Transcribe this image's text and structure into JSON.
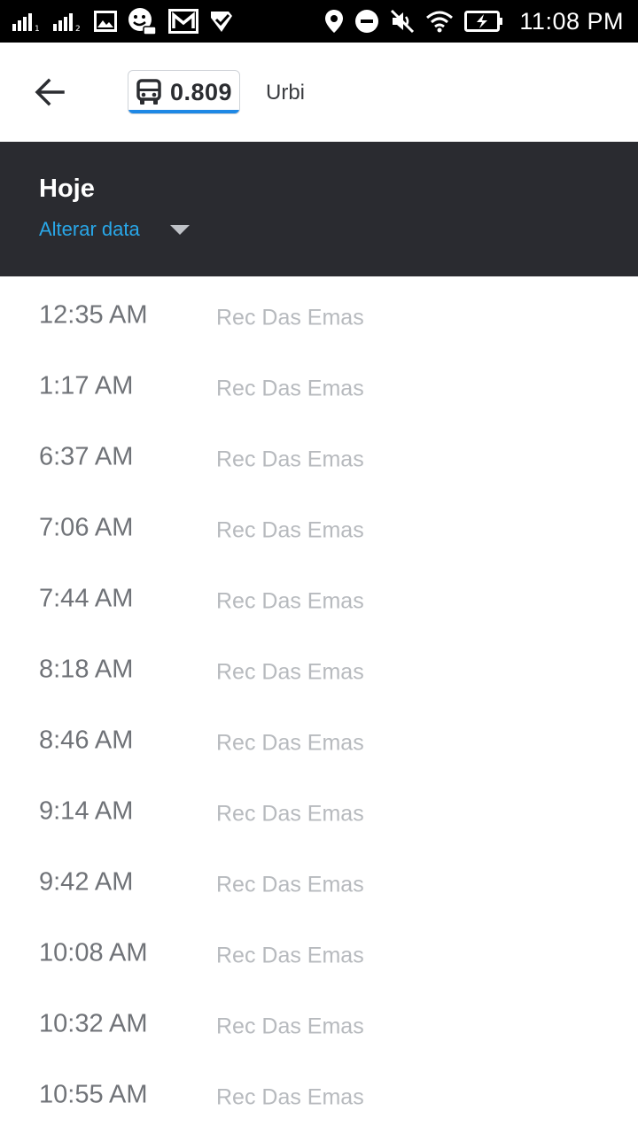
{
  "status_bar": {
    "time": "11:08 PM",
    "left_icons": [
      "signal-1-icon",
      "signal-2-icon",
      "gallery-icon",
      "moovit-icon",
      "gmail-icon",
      "check-app-icon"
    ],
    "right_icons": [
      "location-icon",
      "do-not-disturb-icon",
      "mute-icon",
      "wifi-icon",
      "battery-charging-icon"
    ]
  },
  "app_bar": {
    "back_icon": "arrow-back-icon",
    "route_icon": "bus-icon",
    "route_number": "0.809",
    "operator": "Urbi"
  },
  "date_header": {
    "title": "Hoje",
    "change_label": "Alterar data"
  },
  "schedule": [
    {
      "time": "12:35 AM",
      "destination": "Rec Das Emas"
    },
    {
      "time": "1:17 AM",
      "destination": "Rec Das Emas"
    },
    {
      "time": "6:37 AM",
      "destination": "Rec Das Emas"
    },
    {
      "time": "7:06 AM",
      "destination": "Rec Das Emas"
    },
    {
      "time": "7:44 AM",
      "destination": "Rec Das Emas"
    },
    {
      "time": "8:18 AM",
      "destination": "Rec Das Emas"
    },
    {
      "time": "8:46 AM",
      "destination": "Rec Das Emas"
    },
    {
      "time": "9:14 AM",
      "destination": "Rec Das Emas"
    },
    {
      "time": "9:42 AM",
      "destination": "Rec Das Emas"
    },
    {
      "time": "10:08 AM",
      "destination": "Rec Das Emas"
    },
    {
      "time": "10:32 AM",
      "destination": "Rec Das Emas"
    },
    {
      "time": "10:55 AM",
      "destination": "Rec Das Emas"
    }
  ],
  "colors": {
    "header_bg": "#2a2b30",
    "accent_link": "#29a7e8",
    "route_underline": "#1e88e5"
  }
}
